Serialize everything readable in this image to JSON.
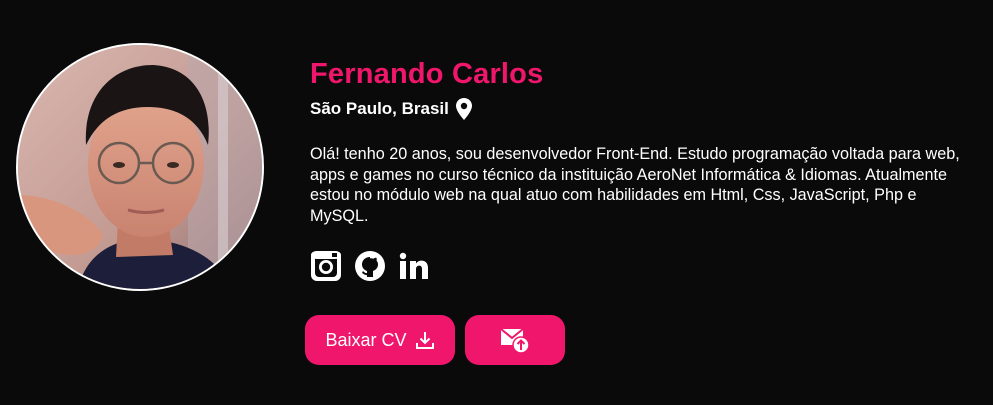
{
  "profile": {
    "name": "Fernando Carlos",
    "location": "São Paulo, Brasil",
    "bio": "Olá! tenho 20 anos, sou desenvolvedor Front-End. Estudo programação voltada para web, apps e games no curso técnico da instituição AeroNet Informática & Idiomas. Atualmente estou no módulo web na qual atuo com habilidades em Html, Css, JavaScript, Php e MySQL."
  },
  "icons": {
    "location": "map-pin-icon",
    "socials": [
      "instagram-icon",
      "github-icon",
      "linkedin-icon"
    ],
    "download": "download-icon",
    "mail": "mail-upload-icon"
  },
  "actions": {
    "download_cv_label": "Baixar CV"
  },
  "colors": {
    "background": "#0b0a0b",
    "accent": "#f0166b",
    "text": "#ffffff"
  }
}
